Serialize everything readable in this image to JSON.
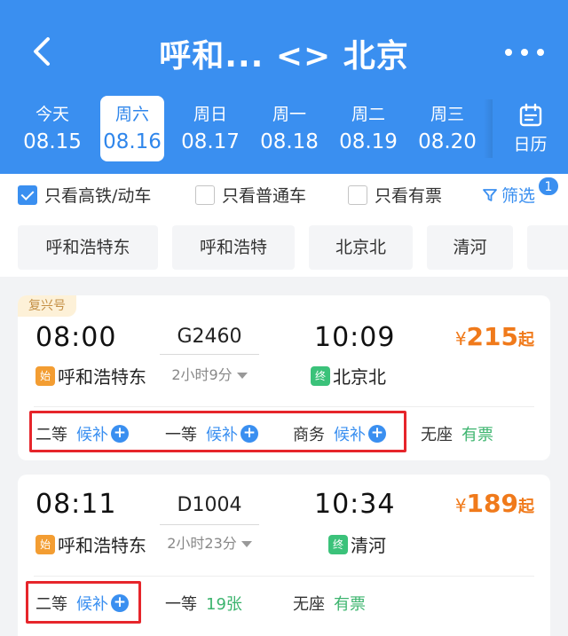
{
  "header": {
    "title": "呼和... <> 北京"
  },
  "dates": [
    {
      "weekday": "今天",
      "date": "08.15",
      "active": false
    },
    {
      "weekday": "周六",
      "date": "08.16",
      "active": true
    },
    {
      "weekday": "周日",
      "date": "08.17",
      "active": false
    },
    {
      "weekday": "周一",
      "date": "08.18",
      "active": false
    },
    {
      "weekday": "周二",
      "date": "08.19",
      "active": false
    },
    {
      "weekday": "周三",
      "date": "08.20",
      "active": false
    }
  ],
  "calendar_label": "日历",
  "filters": {
    "high_speed": {
      "label": "只看高铁/动车",
      "checked": true
    },
    "normal": {
      "label": "只看普通车",
      "checked": false
    },
    "available": {
      "label": "只看有票",
      "checked": false
    },
    "filter_label": "筛选",
    "filter_count": "1"
  },
  "stations": [
    "呼和浩特东",
    "呼和浩特",
    "北京北",
    "清河"
  ],
  "trains": [
    {
      "tag": "复兴号",
      "depart": "08:00",
      "number": "G2460",
      "arrive": "10:09",
      "duration": "2小时9分",
      "price_symbol": "¥",
      "price": "215",
      "price_suffix": "起",
      "start_badge": "始",
      "from": "呼和浩特东",
      "end_badge": "终",
      "to": "北京北",
      "seats": [
        {
          "class": "二等",
          "status": "候补",
          "waitlist": true
        },
        {
          "class": "一等",
          "status": "候补",
          "waitlist": true
        },
        {
          "class": "商务",
          "status": "候补",
          "waitlist": true
        },
        {
          "class": "无座",
          "status": "有票",
          "waitlist": false
        }
      ]
    },
    {
      "depart": "08:11",
      "number": "D1004",
      "arrive": "10:34",
      "duration": "2小时23分",
      "price_symbol": "¥",
      "price": "189",
      "price_suffix": "起",
      "start_badge": "始",
      "from": "呼和浩特东",
      "end_badge": "终",
      "to": "清河",
      "seats": [
        {
          "class": "二等",
          "status": "候补",
          "waitlist": true
        },
        {
          "class": "一等",
          "status": "19张",
          "waitlist": false
        },
        {
          "class": "无座",
          "status": "有票",
          "waitlist": false
        }
      ]
    }
  ],
  "colors": {
    "header_bg": "#3a8ff0",
    "price": "#f07a1b",
    "waitlist": "#3a8ff0",
    "available": "#3cb46e",
    "highlight_box": "#e6252b"
  }
}
